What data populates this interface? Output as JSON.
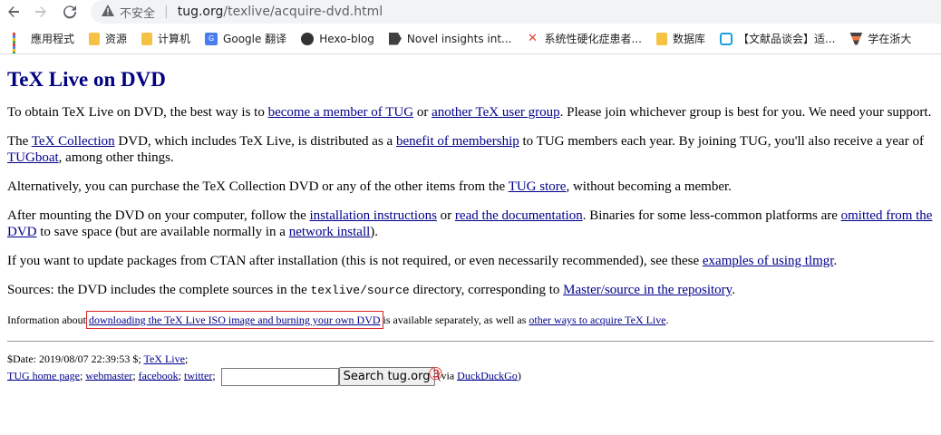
{
  "browser": {
    "security_label": "不安全",
    "url_host": "tug.org",
    "url_path": "/texlive/acquire-dvd.html"
  },
  "bookmarks": [
    {
      "label": "應用程式",
      "icon": "apps-icon"
    },
    {
      "label": "资源",
      "icon": "folder-icon"
    },
    {
      "label": "计算机",
      "icon": "folder-icon"
    },
    {
      "label": "Google 翻译",
      "icon": "google-translate-icon"
    },
    {
      "label": "Hexo-blog",
      "icon": "hexo-icon"
    },
    {
      "label": "Novel insights int...",
      "icon": "novel-icon"
    },
    {
      "label": "系统性硬化症患者...",
      "icon": "x-icon"
    },
    {
      "label": "数据库",
      "icon": "folder-icon"
    },
    {
      "label": "【文献品谈会】适...",
      "icon": "bilibili-icon"
    },
    {
      "label": "学在浙大",
      "icon": "zju-icon"
    }
  ],
  "page": {
    "title": "TeX Live on DVD",
    "p1": {
      "t1": "To obtain TeX Live on DVD, the best way is to ",
      "l1": "become a member of TUG",
      "t2": " or ",
      "l2": "another TeX user group",
      "t3": ". Please join whichever group is best for you. We need your support."
    },
    "p2": {
      "t1": "The ",
      "l1": "TeX Collection",
      "t2": " DVD, which includes TeX Live, is distributed as a ",
      "l2": "benefit of membership",
      "t3": " to TUG members each year. By joining TUG, you'll also receive a year of ",
      "l3": "TUGboat",
      "t4": ", among other things."
    },
    "p3": {
      "t1": "Alternatively, you can purchase the TeX Collection DVD or any of the other items from the ",
      "l1": "TUG store",
      "t2": ", without becoming a member."
    },
    "p4": {
      "t1": "After mounting the DVD on your computer, follow the ",
      "l1": "installation instructions",
      "t2": " or ",
      "l2": "read the documentation",
      "t3": ". Binaries for some less-common platforms are ",
      "l3": "omitted from the DVD",
      "t4": " to save space (but are available normally in a ",
      "l4": "network install",
      "t5": ")."
    },
    "p5": {
      "t1": "If you want to update packages from CTAN after installation (this is not required, or even necessarily recommended), see these ",
      "l1": "examples of using tlmgr",
      "t2": "."
    },
    "p6": {
      "t1": "Sources: the DVD includes the complete sources in the ",
      "code": "texlive/source",
      "t2": " directory, corresponding to ",
      "l1": "Master/source in the repository",
      "t3": "."
    },
    "p7": {
      "t1": "Information about ",
      "l1": "downloading the TeX Live ISO image and burning your own DVD",
      "t2": " is available separately, as well as ",
      "l2": "other ways to acquire TeX Live",
      "t3": "."
    },
    "annotation_mark": "③",
    "footer": {
      "date": "$Date: 2019/08/07 22:39:53 $; ",
      "texlive_link": "TeX Live",
      "semi1": ";",
      "home_link": "TUG home page",
      "webmaster_link": "webmaster",
      "facebook_link": "facebook",
      "twitter_link": "twitter",
      "search_button": "Search tug.org",
      "via_text": " (via ",
      "ddg_link": "DuckDuckGo",
      "close_paren": ")"
    }
  },
  "colors": {
    "title": "#000080",
    "link": "#00008b",
    "highlight": "#d9262b"
  }
}
